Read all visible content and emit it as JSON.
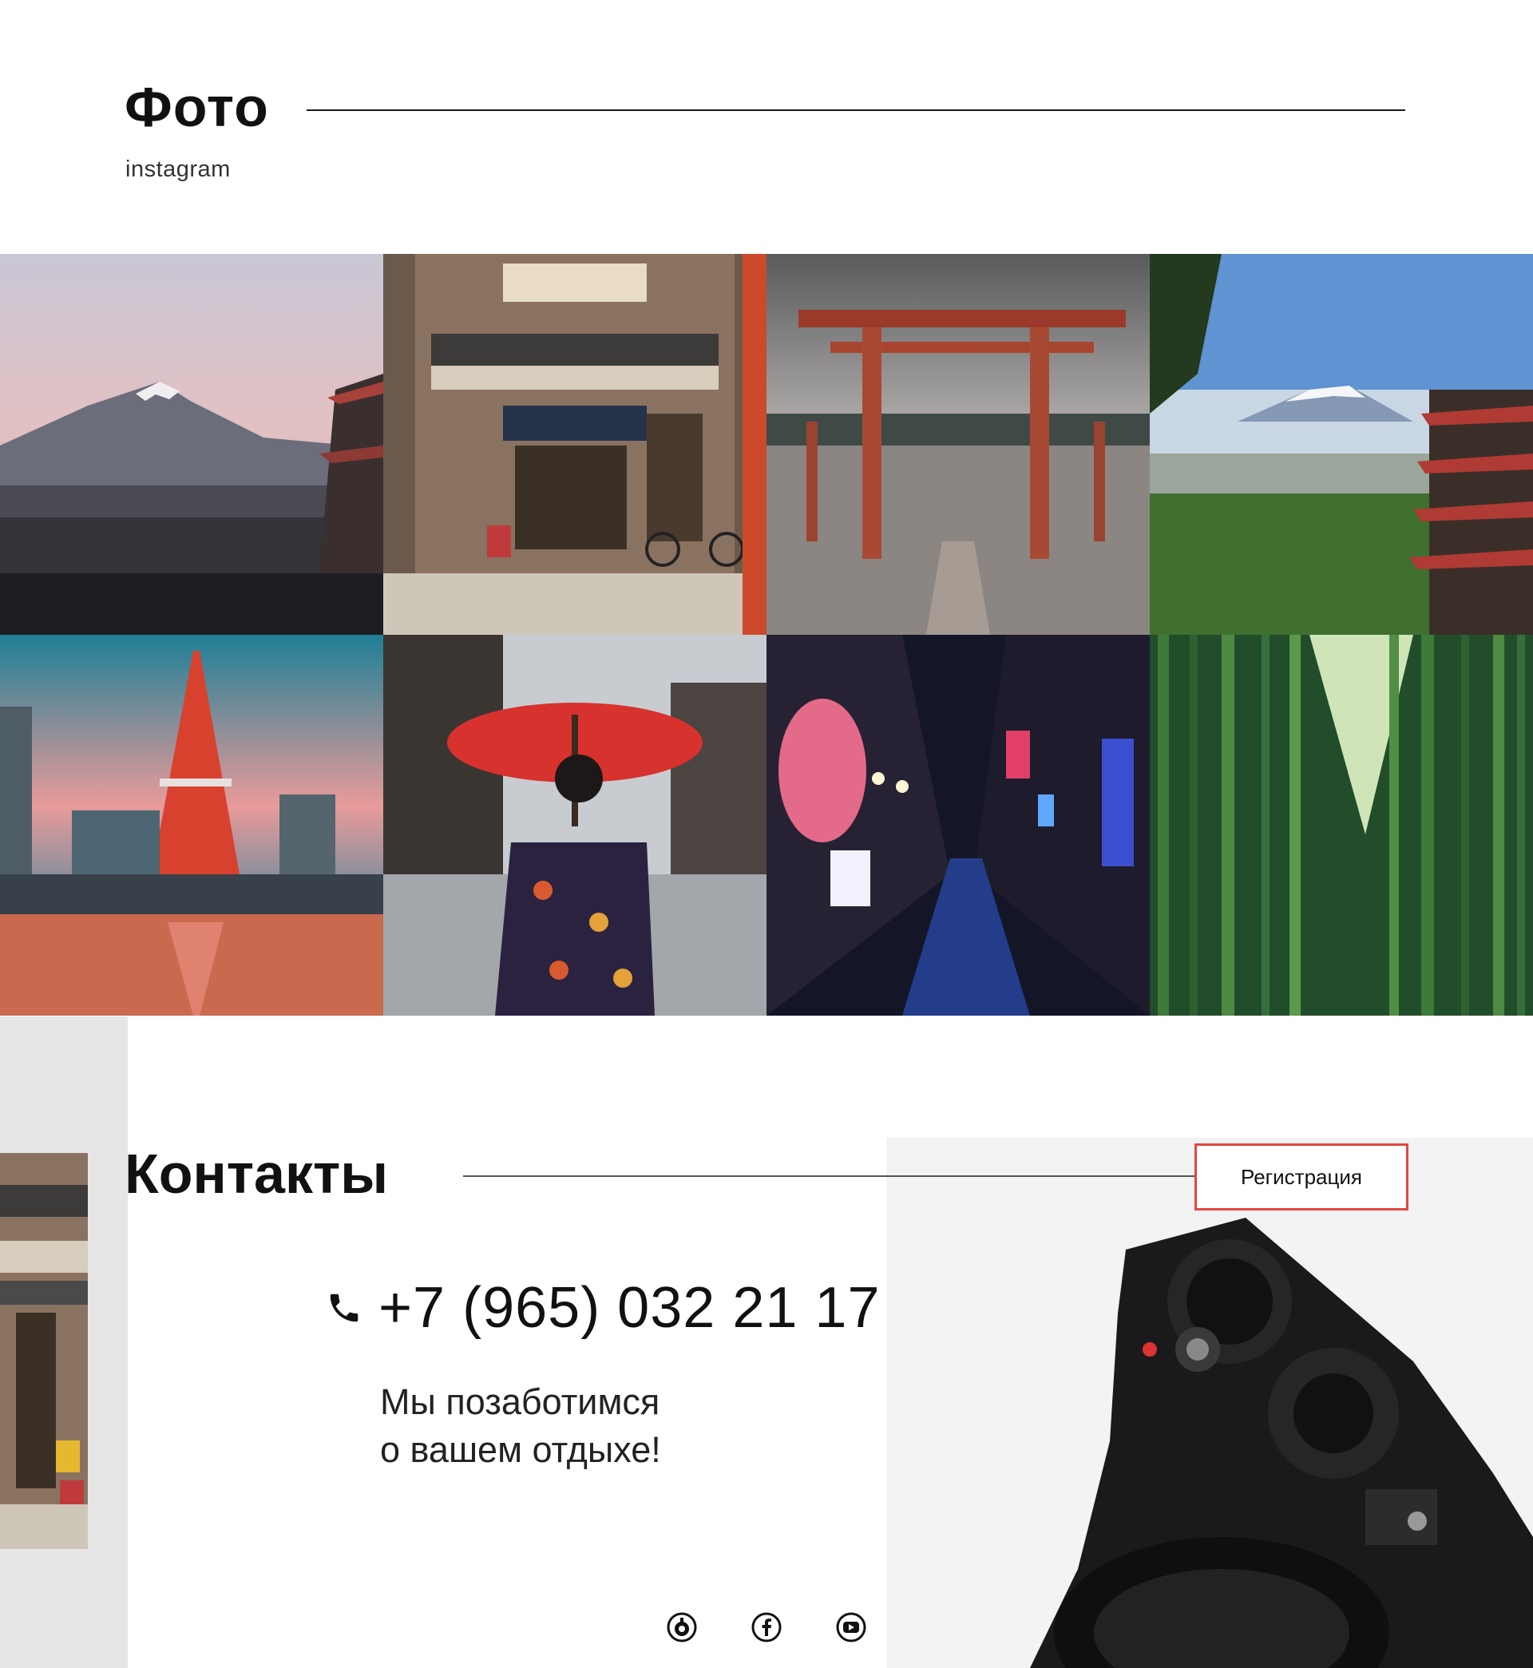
{
  "photo_section": {
    "title": "Фото",
    "subtitle": "instagram"
  },
  "gallery": {
    "photos": [
      {
        "subject": "mount-fuji-dusk"
      },
      {
        "subject": "japanese-shop-front"
      },
      {
        "subject": "torii-gate-in-water"
      },
      {
        "subject": "fuji-with-pagoda"
      },
      {
        "subject": "tokyo-tower-sunset"
      },
      {
        "subject": "geisha-with-red-umbrella"
      },
      {
        "subject": "neon-alley-night"
      },
      {
        "subject": "bamboo-forest"
      }
    ]
  },
  "contacts": {
    "title": "Контакты",
    "register_label": "Регистрация",
    "phone": "+7 (965) 032 21 17",
    "tagline_line1": "Мы позаботимся",
    "tagline_line2": "о вашем отдыхе!",
    "socials": [
      "vk-icon",
      "facebook-icon",
      "youtube-icon"
    ]
  },
  "colors": {
    "accent": "#e2473f",
    "text": "#111111",
    "strip": "#e6e6e6"
  }
}
